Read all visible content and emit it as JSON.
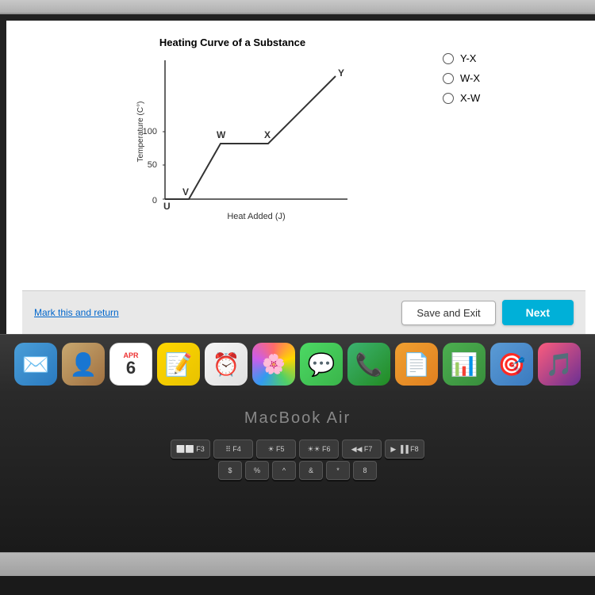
{
  "screen": {
    "chart": {
      "title": "Heating Curve of a Substance",
      "x_axis_label": "Heat Added (J)",
      "y_axis_label": "Temperature (C°)",
      "points": {
        "U": "bottom-left",
        "V": "low",
        "W": "mid",
        "X": "upper-mid",
        "Y": "top-right"
      },
      "y_ticks": [
        "0",
        "50",
        "100"
      ]
    },
    "options": [
      {
        "label": "Y-X",
        "selected": false
      },
      {
        "label": "W-X",
        "selected": false
      },
      {
        "label": "X-W",
        "selected": false
      }
    ],
    "bottom_bar": {
      "mark_link": "Mark this and return",
      "save_button": "Save and Exit",
      "next_button": "Next"
    }
  },
  "laptop": {
    "brand": "MacBook Air",
    "dock": {
      "calendar_month": "APR",
      "calendar_day": "6"
    },
    "keyboard": {
      "rows": [
        [
          "F3",
          "F4",
          "F5",
          "F6",
          "F7",
          "F8"
        ],
        [
          "$",
          "%",
          "^",
          "&",
          "*",
          "8"
        ]
      ]
    }
  }
}
